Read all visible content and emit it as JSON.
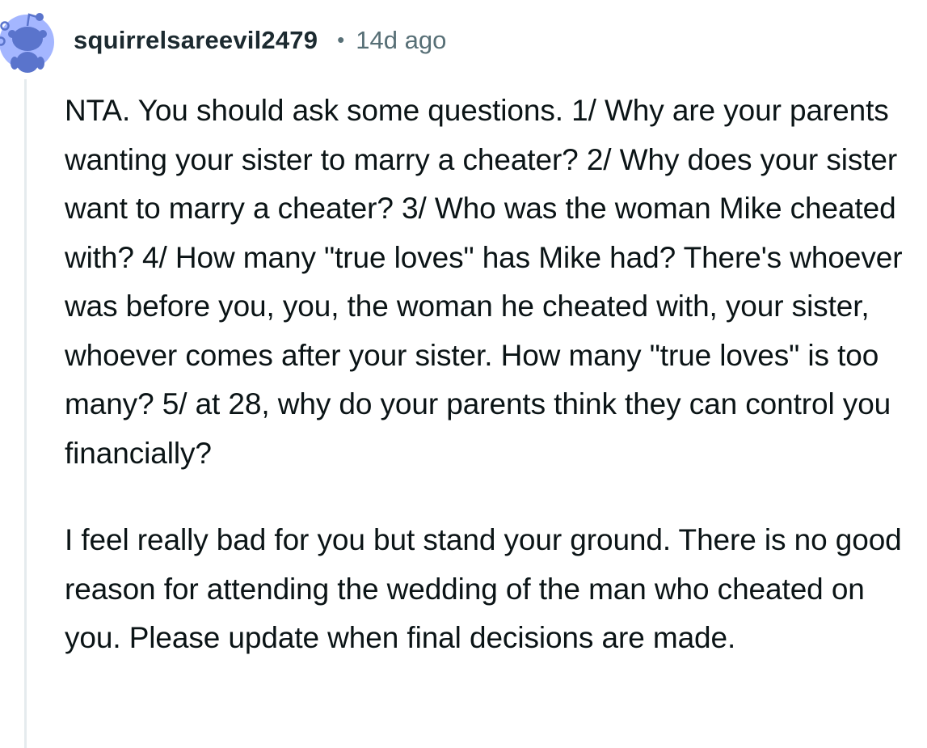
{
  "comment": {
    "username": "squirrelsareevil2479",
    "separator": "•",
    "timestamp": "14d ago",
    "paragraphs": [
      "NTA. You should ask some questions. 1/ Why are your parents wanting your sister to marry a cheater? 2/ Why does your sister want to marry a cheater? 3/ Who was the woman Mike cheated with? 4/ How many \"true loves\" has Mike had? There's whoever was before you, you, the woman he cheated with, your sister, whoever comes after your sister. How many \"true loves\" is too many? 5/ at 28, why do your parents think they can control you financially?",
      "I feel really bad for you but stand your ground. There is no good reason for attending the wedding of the man who cheated on you. Please update when final decisions are made."
    ]
  },
  "avatar": {
    "icon": "snoo-avatar-icon",
    "background_color": "#a4b6ff",
    "figure_color": "#5a74cc"
  },
  "colors": {
    "text": "#0b1416",
    "username": "#1c2a30",
    "meta": "#576f76",
    "thread_line": "#e5ebee"
  }
}
